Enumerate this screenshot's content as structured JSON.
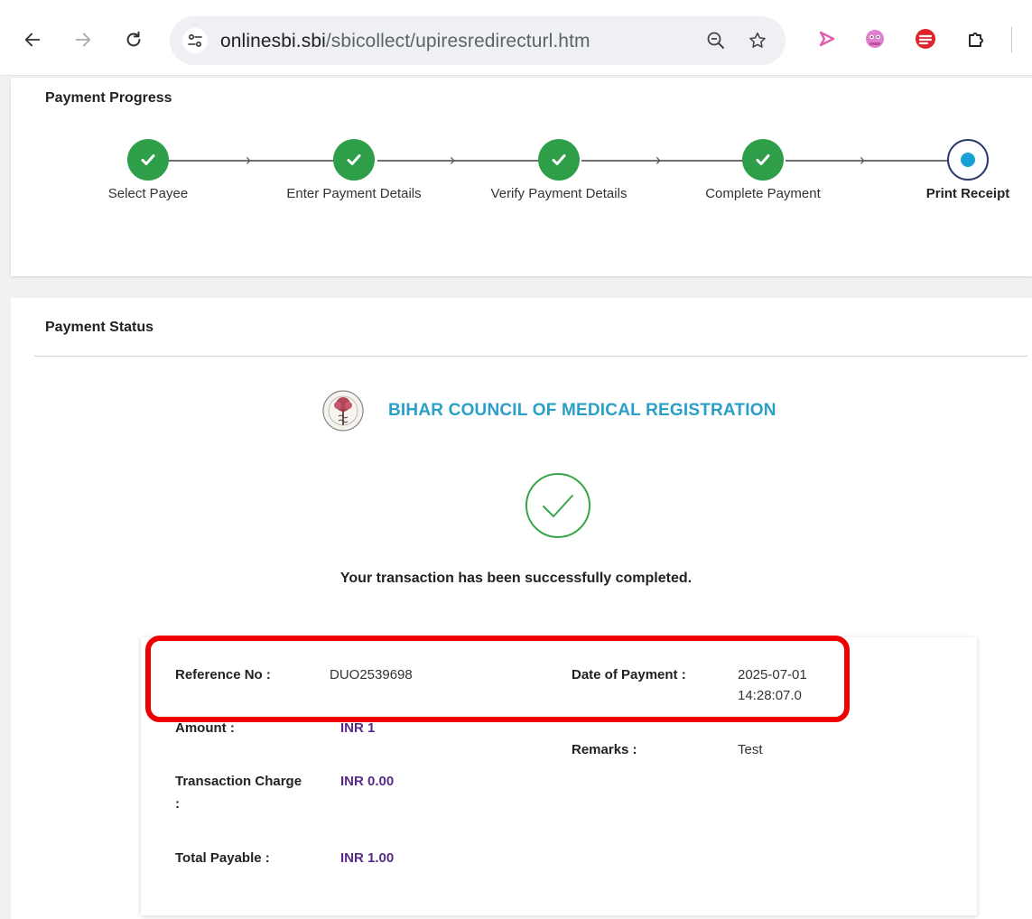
{
  "browser": {
    "url_host": "onlinesbi.sbi",
    "url_path": "/sbicollect/upiresredirecturl.htm"
  },
  "progress": {
    "title": "Payment Progress",
    "steps": [
      {
        "label": "Select Payee",
        "state": "complete"
      },
      {
        "label": "Enter Payment Details",
        "state": "complete"
      },
      {
        "label": "Verify Payment Details",
        "state": "complete"
      },
      {
        "label": "Complete Payment",
        "state": "complete"
      },
      {
        "label": "Print Receipt",
        "state": "current"
      }
    ]
  },
  "status": {
    "title": "Payment Status",
    "org_name": "BIHAR COUNCIL OF MEDICAL REGISTRATION",
    "message": "Your transaction has been successfully completed."
  },
  "receipt": {
    "reference_label": "Reference No :",
    "reference_value": "DUO2539698",
    "date_label": "Date of Payment :",
    "date_line1": "2025-07-01",
    "date_line2": "14:28:07.0",
    "amount_label": "Amount :",
    "amount_value": "INR 1",
    "remarks_label": "Remarks :",
    "remarks_value": "Test",
    "charge_label_line1": "Transaction Charge",
    "charge_label_line2": ":",
    "charge_value": "INR 0.00",
    "total_label": "Total Payable :",
    "total_value": "INR 1.00"
  },
  "colors": {
    "step_complete": "#2e9e48",
    "step_current_dot": "#1aa0d8",
    "org_name": "#2a9fc8",
    "amount_text": "#5a2a8a",
    "highlight": "#ee0000"
  }
}
